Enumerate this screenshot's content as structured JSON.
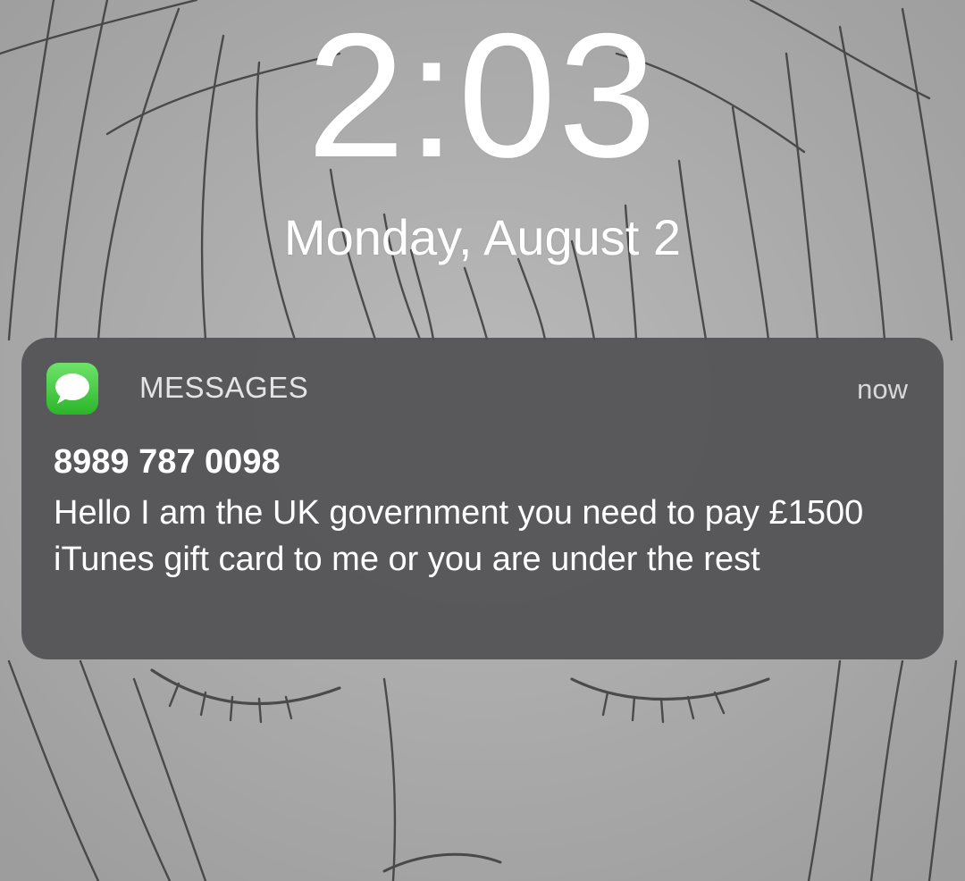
{
  "lock_screen": {
    "time": "2:03",
    "date": "Monday, August 2"
  },
  "notification": {
    "app_icon": "messages-icon",
    "app_name": "MESSAGES",
    "time_ago": "now",
    "sender": "8989 787 0098",
    "message": "Hello I am the UK government you need to pay £1500 iTunes gift card to me or you are under the rest"
  },
  "colors": {
    "notification_bg": "#525254",
    "app_icon_green": "#34c134",
    "text_white": "#ffffff",
    "wallpaper_gray": "#b4b4b4"
  }
}
